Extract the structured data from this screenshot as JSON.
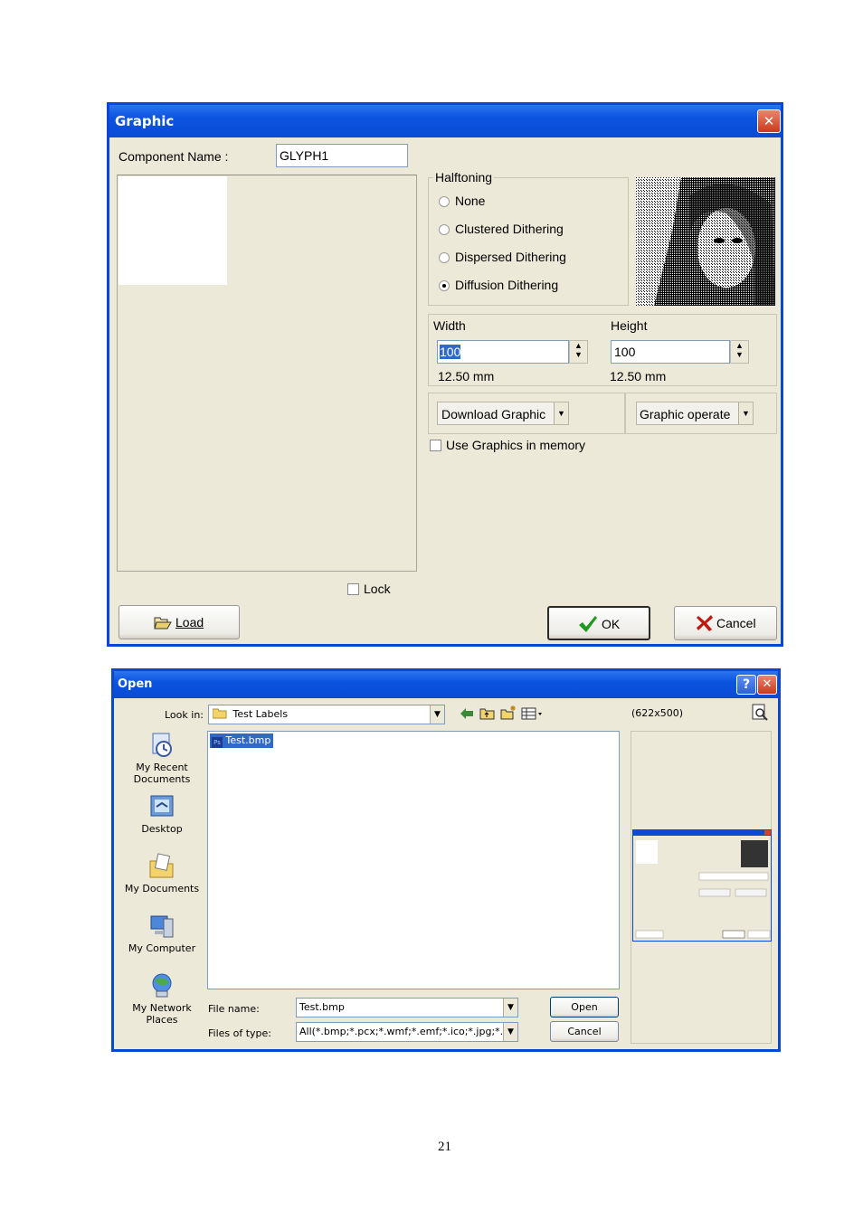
{
  "graphic_dialog": {
    "title": "Graphic",
    "close_glyph": "✕",
    "component_name_label": "Component Name :",
    "component_name_value": "GLYPH1",
    "halftoning": {
      "legend": "Halftoning",
      "options": [
        "None",
        "Clustered Dithering",
        "Dispersed Dithering",
        "Diffusion Dithering"
      ],
      "selected": "Diffusion Dithering"
    },
    "width_label": "Width",
    "width_value": "100",
    "width_mm": "12.50 mm",
    "height_label": "Height",
    "height_value": "100",
    "height_mm": "12.50 mm",
    "download_graphic_label": "Download Graphic",
    "graphic_operate_label": "Graphic operate",
    "use_graphics_memory_label": "Use Graphics in memory",
    "lock_label": "Lock",
    "load_label": "Load",
    "ok_label": "OK",
    "cancel_label": "Cancel"
  },
  "open_dialog": {
    "title": "Open",
    "help_glyph": "?",
    "close_glyph": "✕",
    "look_in_label": "Look in:",
    "look_in_value": "Test Labels",
    "preview_size": "(622x500)",
    "places": [
      {
        "label_line1": "My Recent",
        "label_line2": "Documents",
        "icon": "recent-documents-icon"
      },
      {
        "label_line1": "Desktop",
        "label_line2": "",
        "icon": "desktop-icon"
      },
      {
        "label_line1": "My Documents",
        "label_line2": "",
        "icon": "my-documents-icon"
      },
      {
        "label_line1": "My Computer",
        "label_line2": "",
        "icon": "my-computer-icon"
      },
      {
        "label_line1": "My Network",
        "label_line2": "Places",
        "icon": "network-places-icon"
      }
    ],
    "files": [
      {
        "name": "Test.bmp",
        "badge": "Ps",
        "selected": true
      }
    ],
    "file_name_label": "File name:",
    "file_name_value": "Test.bmp",
    "files_of_type_label": "Files of type:",
    "files_of_type_value": "All(*.bmp;*.pcx;*.wmf;*.emf;*.ico;*.jpg;*.jpeg)",
    "open_label": "Open",
    "cancel_label": "Cancel"
  },
  "page_number": "21",
  "colors": {
    "xp_blue": "#0a4bd3",
    "dialog_bg": "#ece9d8",
    "selection": "#316ac5"
  }
}
